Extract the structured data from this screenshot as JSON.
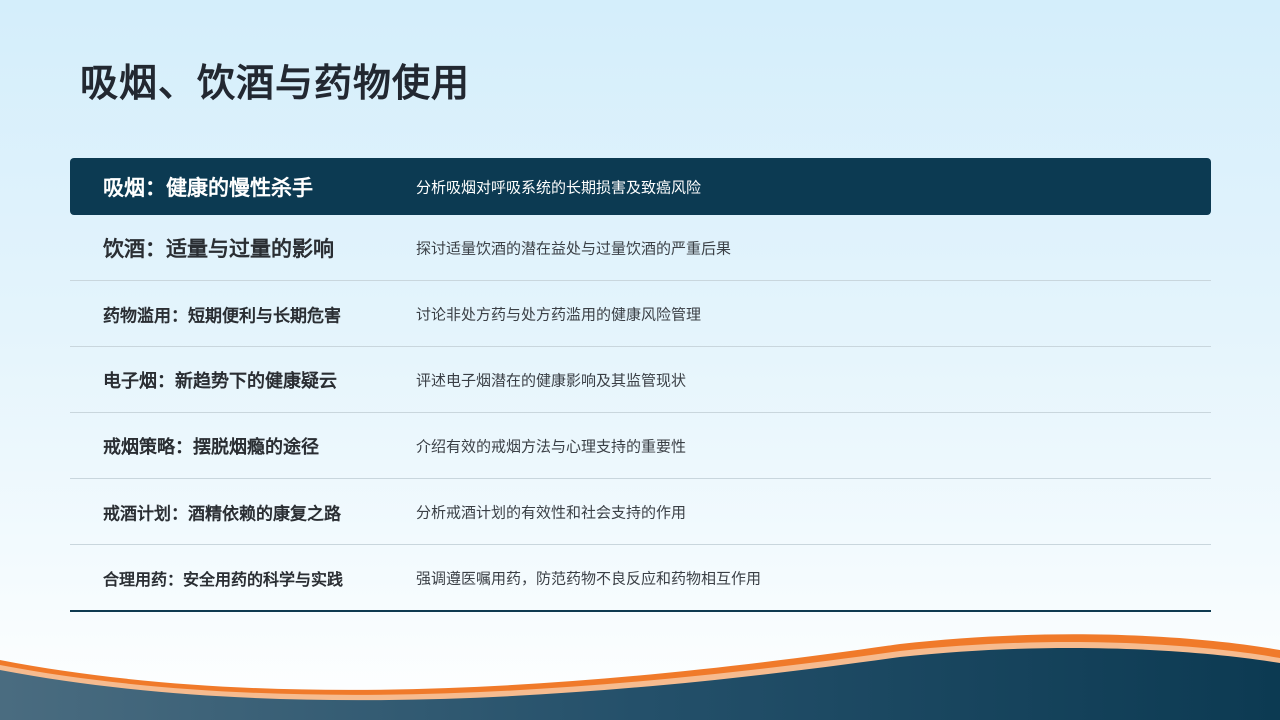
{
  "slide": {
    "title": "吸烟、饮酒与药物使用"
  },
  "topics": [
    {
      "title": "吸烟：健康的慢性杀手",
      "description": "分析吸烟对呼吸系统的长期损害及致癌风险",
      "active": true
    },
    {
      "title": "饮酒：适量与过量的影响",
      "description": "探讨适量饮酒的潜在益处与过量饮酒的严重后果",
      "active": false
    },
    {
      "title": "药物滥用：短期便利与长期危害",
      "description": "讨论非处方药与处方药滥用的健康风险管理",
      "active": false
    },
    {
      "title": "电子烟：新趋势下的健康疑云",
      "description": "评述电子烟潜在的健康影响及其监管现状",
      "active": false
    },
    {
      "title": "戒烟策略：摆脱烟瘾的途径",
      "description": "介绍有效的戒烟方法与心理支持的重要性",
      "active": false
    },
    {
      "title": "戒酒计划：酒精依赖的康复之路",
      "description": "分析戒酒计划的有效性和社会支持的作用",
      "active": false
    },
    {
      "title": "合理用药：安全用药的科学与实践",
      "description": "强调遵医嘱用药，防范药物不良反应和药物相互作用",
      "active": false
    }
  ],
  "colors": {
    "accent_dark": "#0c3a52",
    "accent_orange": "#f07a2a"
  }
}
